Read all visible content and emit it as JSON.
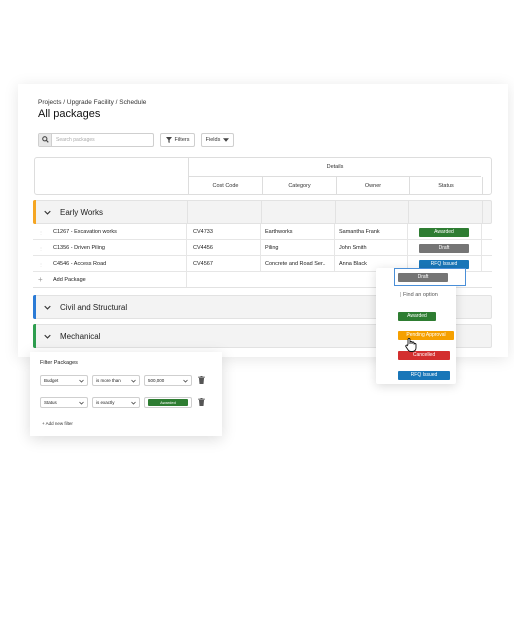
{
  "breadcrumb": "Projects / Upgrade Facility / Schedule",
  "page_title": "All packages",
  "search": {
    "placeholder": "Search packages"
  },
  "toolbar": {
    "filters_label": "Filters",
    "fields_label": "Fields"
  },
  "table": {
    "details_label": "Details",
    "columns": [
      "Cost Code",
      "Category",
      "Owner",
      "Status"
    ]
  },
  "groups": [
    {
      "name": "Early Works",
      "color": "#f5a623",
      "rows": [
        {
          "package": "C1267 -  Excavation works",
          "cost_code": "CV4733",
          "category": "Earthworks",
          "owner": "Samantha Frank",
          "status": "Awarded",
          "status_color": "#2e7d32"
        },
        {
          "package": "C1356 - Driven Piling",
          "cost_code": "CV4456",
          "category": "Piling",
          "owner": "John Smith",
          "status": "Draft",
          "status_color": "#757575"
        },
        {
          "package": "C4546 - Access Road",
          "cost_code": "CV4567",
          "category": "Concrete and Road Ser..",
          "owner": "Anna Black",
          "status": "RFQ Issued",
          "status_color": "#1976b8"
        }
      ],
      "add_label": "Add Package"
    },
    {
      "name": "Civil and Structural",
      "color": "#2b7bd6"
    },
    {
      "name": "Mechanical",
      "color": "#2e9e4f"
    }
  ],
  "status_dropdown": {
    "selected": "Draft",
    "find_placeholder": "Find an option",
    "options": [
      {
        "label": "Awarded",
        "color": "#2e7d32"
      },
      {
        "label": "Pending Approval",
        "color": "#f5a000"
      },
      {
        "label": "Cancelled",
        "color": "#d32f2f"
      },
      {
        "label": "RFQ Issued",
        "color": "#1976b8"
      }
    ]
  },
  "filter_panel": {
    "title": "Filter Packages",
    "filters": [
      {
        "field": "Budget",
        "operator": "is more than",
        "value": "500,000"
      },
      {
        "field": "Status",
        "operator": "is exactly",
        "value": "Awarded",
        "value_color": "#2e7d32"
      }
    ],
    "add_label": "Add new filter"
  }
}
